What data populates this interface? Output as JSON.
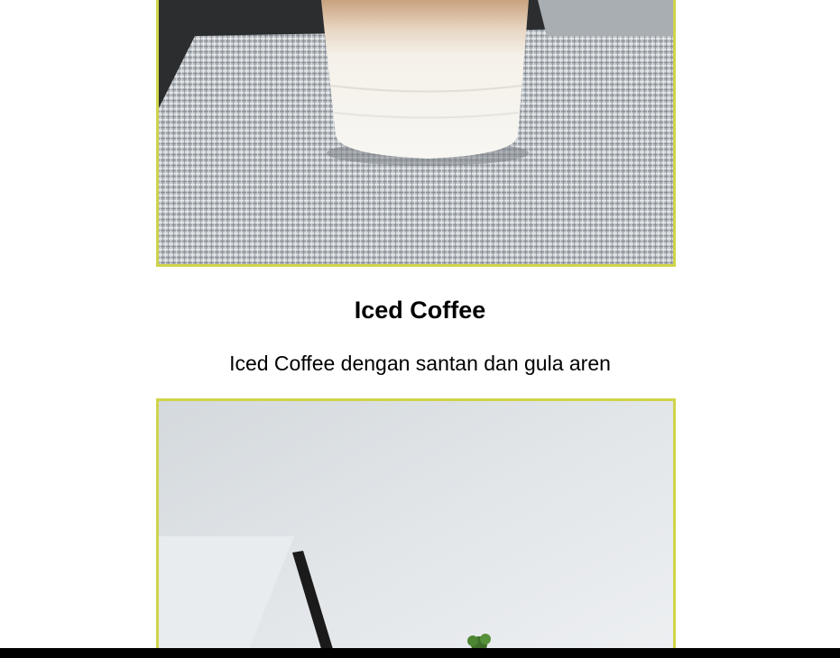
{
  "menu_item": {
    "title": "Iced Coffee",
    "description": "Iced Coffee dengan santan dan gula aren"
  },
  "images": {
    "top_photo": "iced-coffee-photo",
    "bottom_photo": "matcha-drink-photo"
  },
  "colors": {
    "frame_border": "#cfd44a",
    "text": "#000000",
    "background": "#ffffff"
  }
}
